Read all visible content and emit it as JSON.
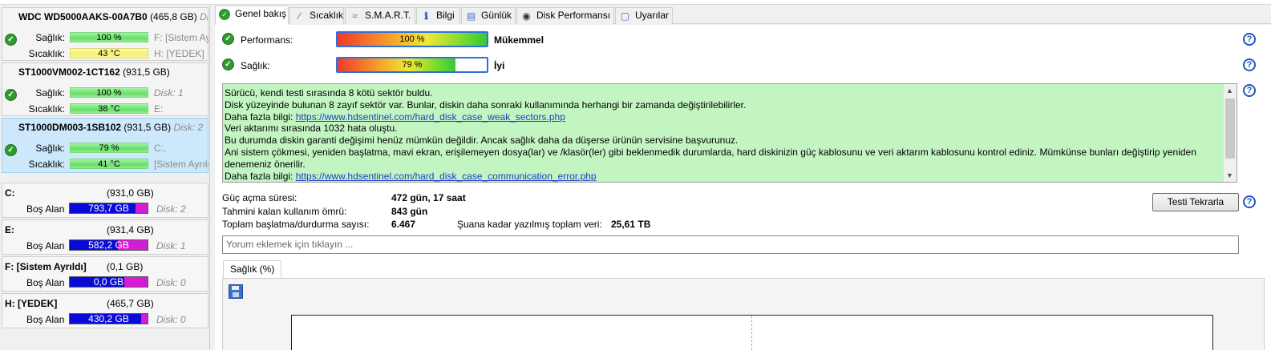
{
  "disks": [
    {
      "model": "WDC WD5000AAKS-00A7B0",
      "size": "(465,8 GB)",
      "slot": "Dis",
      "health_label": "Sağlık:",
      "health": "100 %",
      "temp_label": "Sıcaklık:",
      "temp": "43 °C",
      "vol1": "F: [Sistem Ay",
      "vol2": "H: [YEDEK]"
    },
    {
      "model": "ST1000VM002-1CT162",
      "size": "(931,5 GB)",
      "slot": "",
      "health_label": "Sağlık:",
      "health": "100 %",
      "temp_label": "Sıcaklık:",
      "temp": "38 °C",
      "vol1": "Disk: 1",
      "vol2": "E:"
    },
    {
      "model": "ST1000DM003-1SB102",
      "size": "(931,5 GB)",
      "slot": "Disk: 2",
      "health_label": "Sağlık:",
      "health": "79 %",
      "temp_label": "Sıcaklık:",
      "temp": "41 °C",
      "vol1": "C:,",
      "vol2": "[Sistem Ayrıld"
    }
  ],
  "volumes": [
    {
      "name": "C:",
      "size": "(931,0 GB)",
      "free_label": "Boş Alan",
      "free": "793,7 GB",
      "free_fraction": 0.85,
      "disk": "Disk: 2"
    },
    {
      "name": "E:",
      "size": "(931,4 GB)",
      "free_label": "Boş Alan",
      "free": "582,2 GB",
      "free_fraction": 0.62,
      "disk": "Disk: 1"
    },
    {
      "name": "F: [Sistem Ayrıldı]",
      "size": "(0,1 GB)",
      "free_label": "Boş Alan",
      "free": "0,0 GB",
      "free_fraction": 0.7,
      "disk": "Disk: 0"
    },
    {
      "name": "H: [YEDEK]",
      "size": "(465,7 GB)",
      "free_label": "Boş Alan",
      "free": "430,2 GB",
      "free_fraction": 0.92,
      "disk": "Disk: 0"
    }
  ],
  "tabs": [
    "Genel bakış",
    "Sıcaklık",
    "S.M.A.R.T.",
    "Bilgi",
    "Günlük",
    "Disk Performansı",
    "Uyarılar"
  ],
  "overview": {
    "performance_label": "Performans:",
    "performance": "100 %",
    "performance_value": 100,
    "performance_word": "Mükemmel",
    "health_label": "Sağlık:",
    "health": "79 %",
    "health_value": 79,
    "health_word": "İyi"
  },
  "message": {
    "line1": "Sürücü, kendi testi sırasında 8 kötü sektör buldu.",
    "line2": "Disk yüzeyinde bulunan 8 zayıf sektör var. Bunlar, diskin daha sonraki kullanımında herhangi bir zamanda değiştirilebilirler.",
    "info_prefix": "Daha fazla bilgi: ",
    "link1": "https://www.hdsentinel.com/hard_disk_case_weak_sectors.php",
    "line3": "Veri aktarımı sırasında 1032 hata oluştu.",
    "line4": "Bu durumda diskin garanti değişimi henüz mümkün değildir. Ancak sağlık daha da düşerse ürünün servisine başvurunuz.",
    "line5": "Ani sistem çökmesi, yeniden başlatma, mavi ekran, erişilemeyen dosya(lar) ve /klasör(ler) gibi beklenmedik durumlarda, hard diskinizin güç kablosunu ve veri aktarım kablosunu kontrol ediniz. Mümkünse bunları değiştirip yeniden denemeniz önerilir.",
    "link2": "https://www.hdsentinel.com/hard_disk_case_communication_error.php"
  },
  "stats": {
    "power_on_label": "Güç açma süresi:",
    "power_on": "472 gün, 17 saat",
    "remaining_label": "Tahmini kalan kullanım ömrü:",
    "remaining": "843 gün",
    "starts_label": "Toplam başlatma/durdurma sayısı:",
    "starts": "6.467",
    "written_label": "Şuana kadar yazılmış toplam veri:",
    "written": "25,61 TB"
  },
  "retest_button": "Testi Tekrarla",
  "comment_placeholder": "Yorum eklemek için tıklayın ...",
  "chart_tab": "Sağlık (%)"
}
